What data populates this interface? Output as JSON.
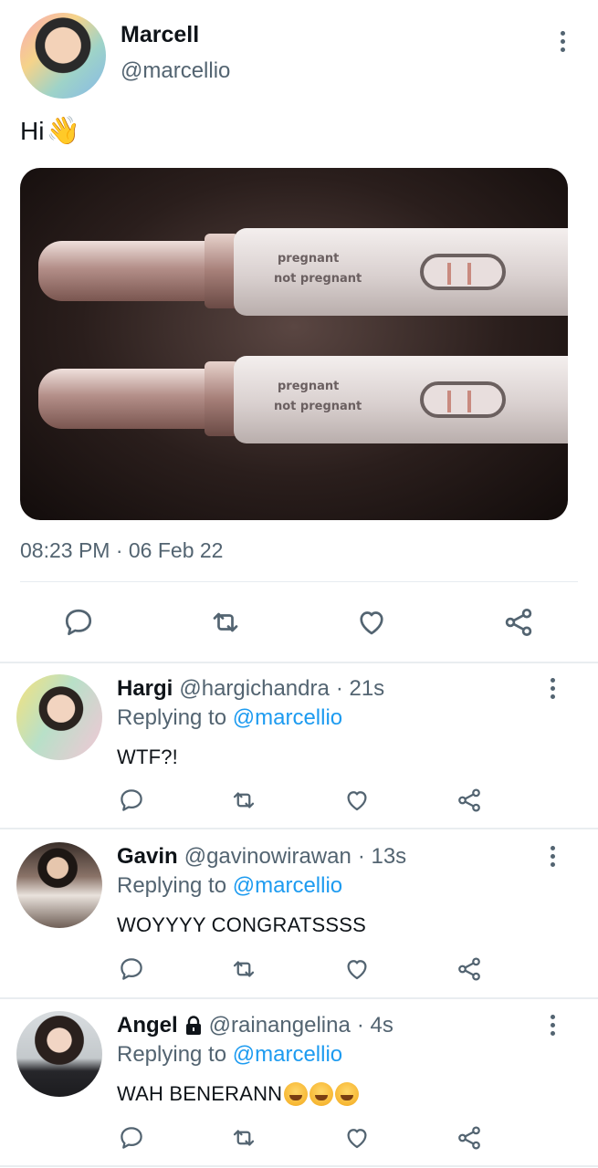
{
  "tweet": {
    "author_name": "Marcell",
    "author_handle": "@marcellio",
    "text": "Hi",
    "text_emoji": "👋",
    "media_labels": {
      "pregnant": "pregnant",
      "not_pregnant": "not pregnant"
    },
    "timestamp": "08:23 PM · 06 Feb 22"
  },
  "replies": [
    {
      "name": "Hargi",
      "handle": "@hargichandra",
      "time": "· 21s",
      "replying_prefix": "Replying to",
      "replying_to": "@marcellio",
      "text": "WTF?!"
    },
    {
      "name": "Gavin",
      "handle": "@gavinowirawan",
      "time": "· 13s",
      "replying_prefix": "Replying to",
      "replying_to": "@marcellio",
      "text": "WOYYYY CONGRATSSSS"
    },
    {
      "name": "Angel",
      "handle": "@rainangelina",
      "time": "· 4s",
      "replying_prefix": "Replying to",
      "replying_to": "@marcellio",
      "text": "WAH BENERANN",
      "protected": true
    }
  ],
  "icons": [
    "comment-icon",
    "retweet-icon",
    "like-icon",
    "share-icon",
    "more-options-icon",
    "lock-icon"
  ],
  "colors": {
    "text_primary": "#0f1419",
    "text_secondary": "#536471",
    "link": "#1d9bf0",
    "divider": "#e6ecf0"
  }
}
